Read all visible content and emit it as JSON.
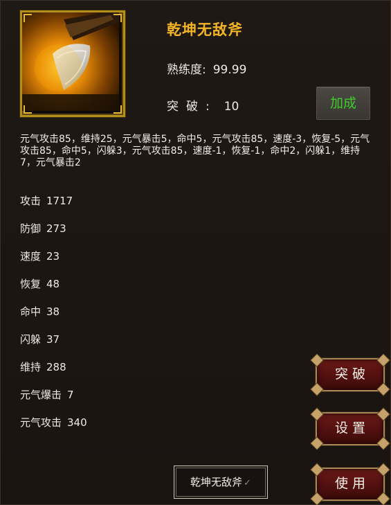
{
  "item": {
    "name": "乾坤无敌斧",
    "proficiency_label": "熟练度:",
    "proficiency_value": "99.99",
    "breakthrough_label": "突破:",
    "breakthrough_value": "10",
    "bonus_button": "加成"
  },
  "description": "元气攻击85，维持25，元气暴击5，命中5，元气攻击85，速度-3，恢复-5，元气攻击85，命中5，闪躲3，元气攻击85，速度-1，恢复-1，命中2，闪躲1，维持7，元气暴击2",
  "stats": [
    {
      "label": "攻击",
      "value": "1717"
    },
    {
      "label": "防御",
      "value": "273"
    },
    {
      "label": "速度",
      "value": "23"
    },
    {
      "label": "恢复",
      "value": "48"
    },
    {
      "label": "命中",
      "value": "38"
    },
    {
      "label": "闪躲",
      "value": "37"
    },
    {
      "label": "维持",
      "value": "288"
    },
    {
      "label": "元气爆击",
      "value": "7"
    },
    {
      "label": "元气攻击",
      "value": "340"
    }
  ],
  "buttons": {
    "breakthrough": "突破",
    "settings": "设置",
    "use": "使用"
  },
  "name_tab": {
    "label": "乾坤无敌斧",
    "check_icon": "checkmark-icon"
  },
  "colors": {
    "title_gold": "#f3b526",
    "bonus_green": "#3fcc2b",
    "button_red": "#571210",
    "frame_gold": "#b58f1e"
  },
  "icons": {
    "item_icon": "golden-axe-icon"
  }
}
